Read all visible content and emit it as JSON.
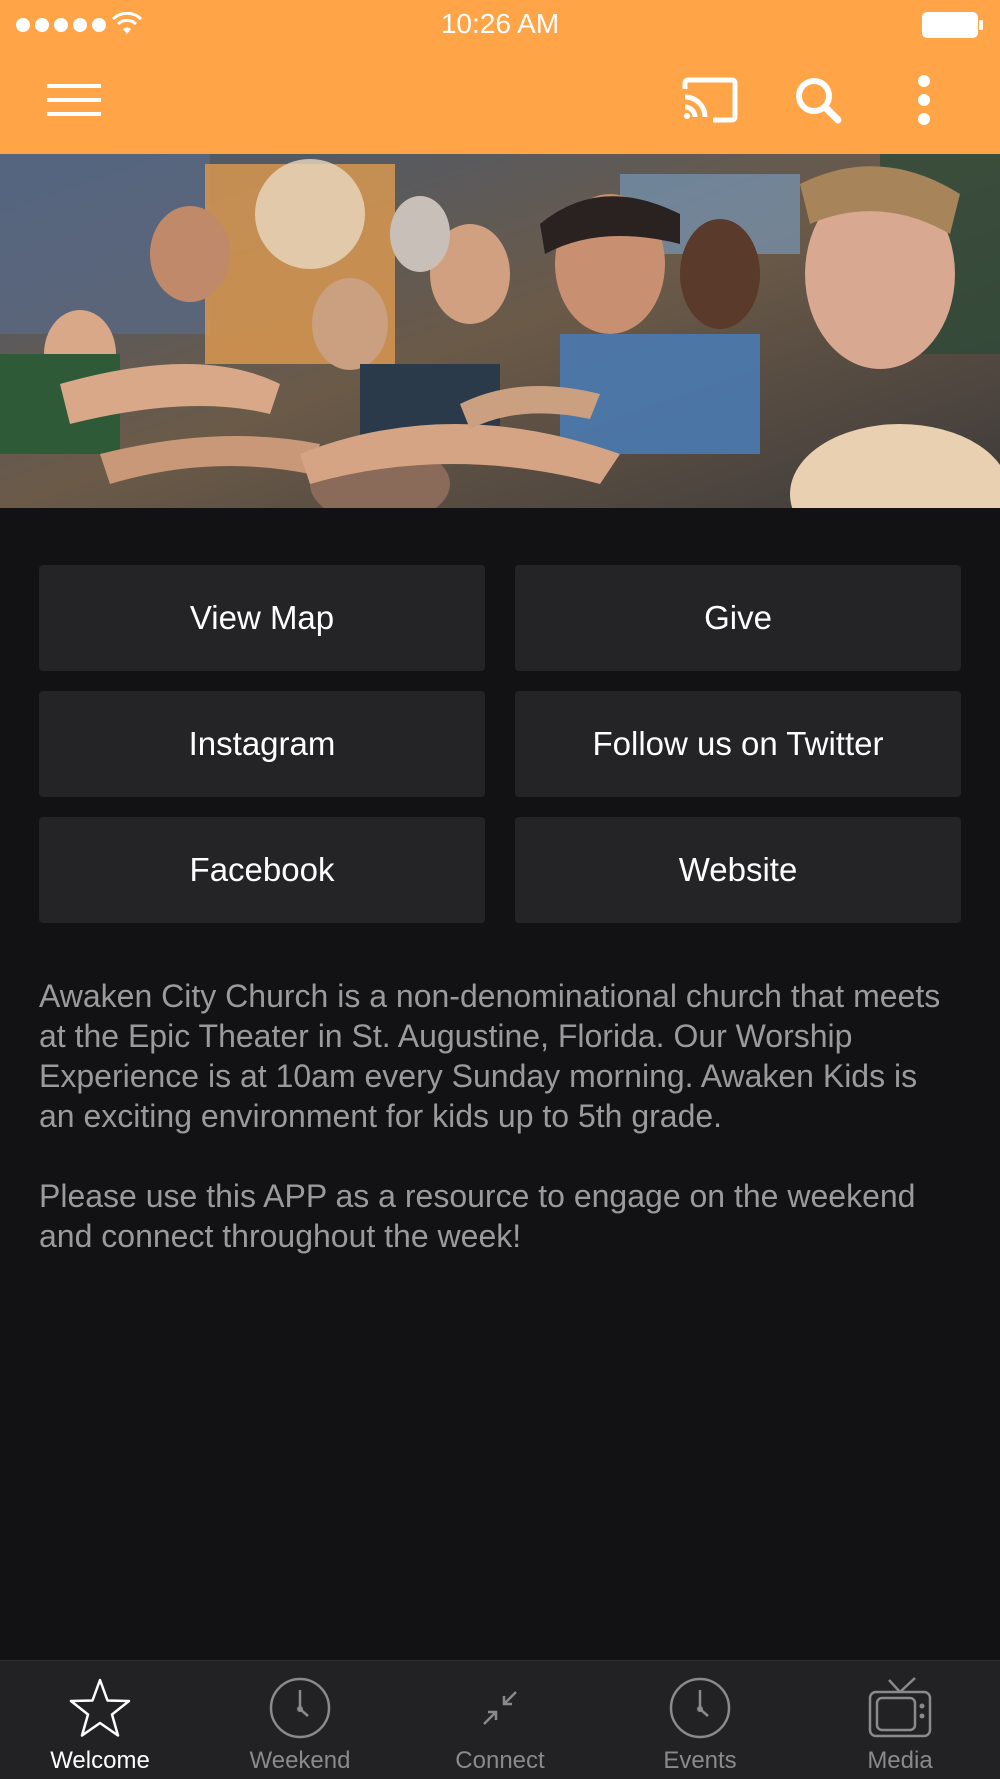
{
  "status_bar": {
    "time": "10:26 AM",
    "icons": [
      "signal-dots",
      "wifi-icon",
      "battery-icon"
    ]
  },
  "app_bar": {
    "accent_color": "#FFA447",
    "icons": [
      "hamburger-menu-icon",
      "cast-icon",
      "search-icon",
      "more-vertical-icon"
    ]
  },
  "hero": {
    "description": "photo"
  },
  "buttons": [
    {
      "label": "View Map"
    },
    {
      "label": "Give"
    },
    {
      "label": "Instagram"
    },
    {
      "label": "Follow us on Twitter"
    },
    {
      "label": "Facebook"
    },
    {
      "label": "Website"
    }
  ],
  "description": {
    "paragraph1": "Awaken City Church is a non-denominational church that meets at the Epic Theater in St. Augustine, Florida. Our Worship Experience is at 10am every Sunday morning. Awaken Kids is an exciting environment for kids up to 5th grade.",
    "paragraph2": "Please use this APP as a resource to engage on the weekend and connect throughout the week!"
  },
  "tabs": [
    {
      "label": "Welcome",
      "icon": "star-icon",
      "active": true
    },
    {
      "label": "Weekend",
      "icon": "clock-icon",
      "active": false
    },
    {
      "label": "Connect",
      "icon": "connect-arrows-icon",
      "active": false
    },
    {
      "label": "Events",
      "icon": "clock-icon",
      "active": false
    },
    {
      "label": "Media",
      "icon": "tv-icon",
      "active": false
    }
  ]
}
